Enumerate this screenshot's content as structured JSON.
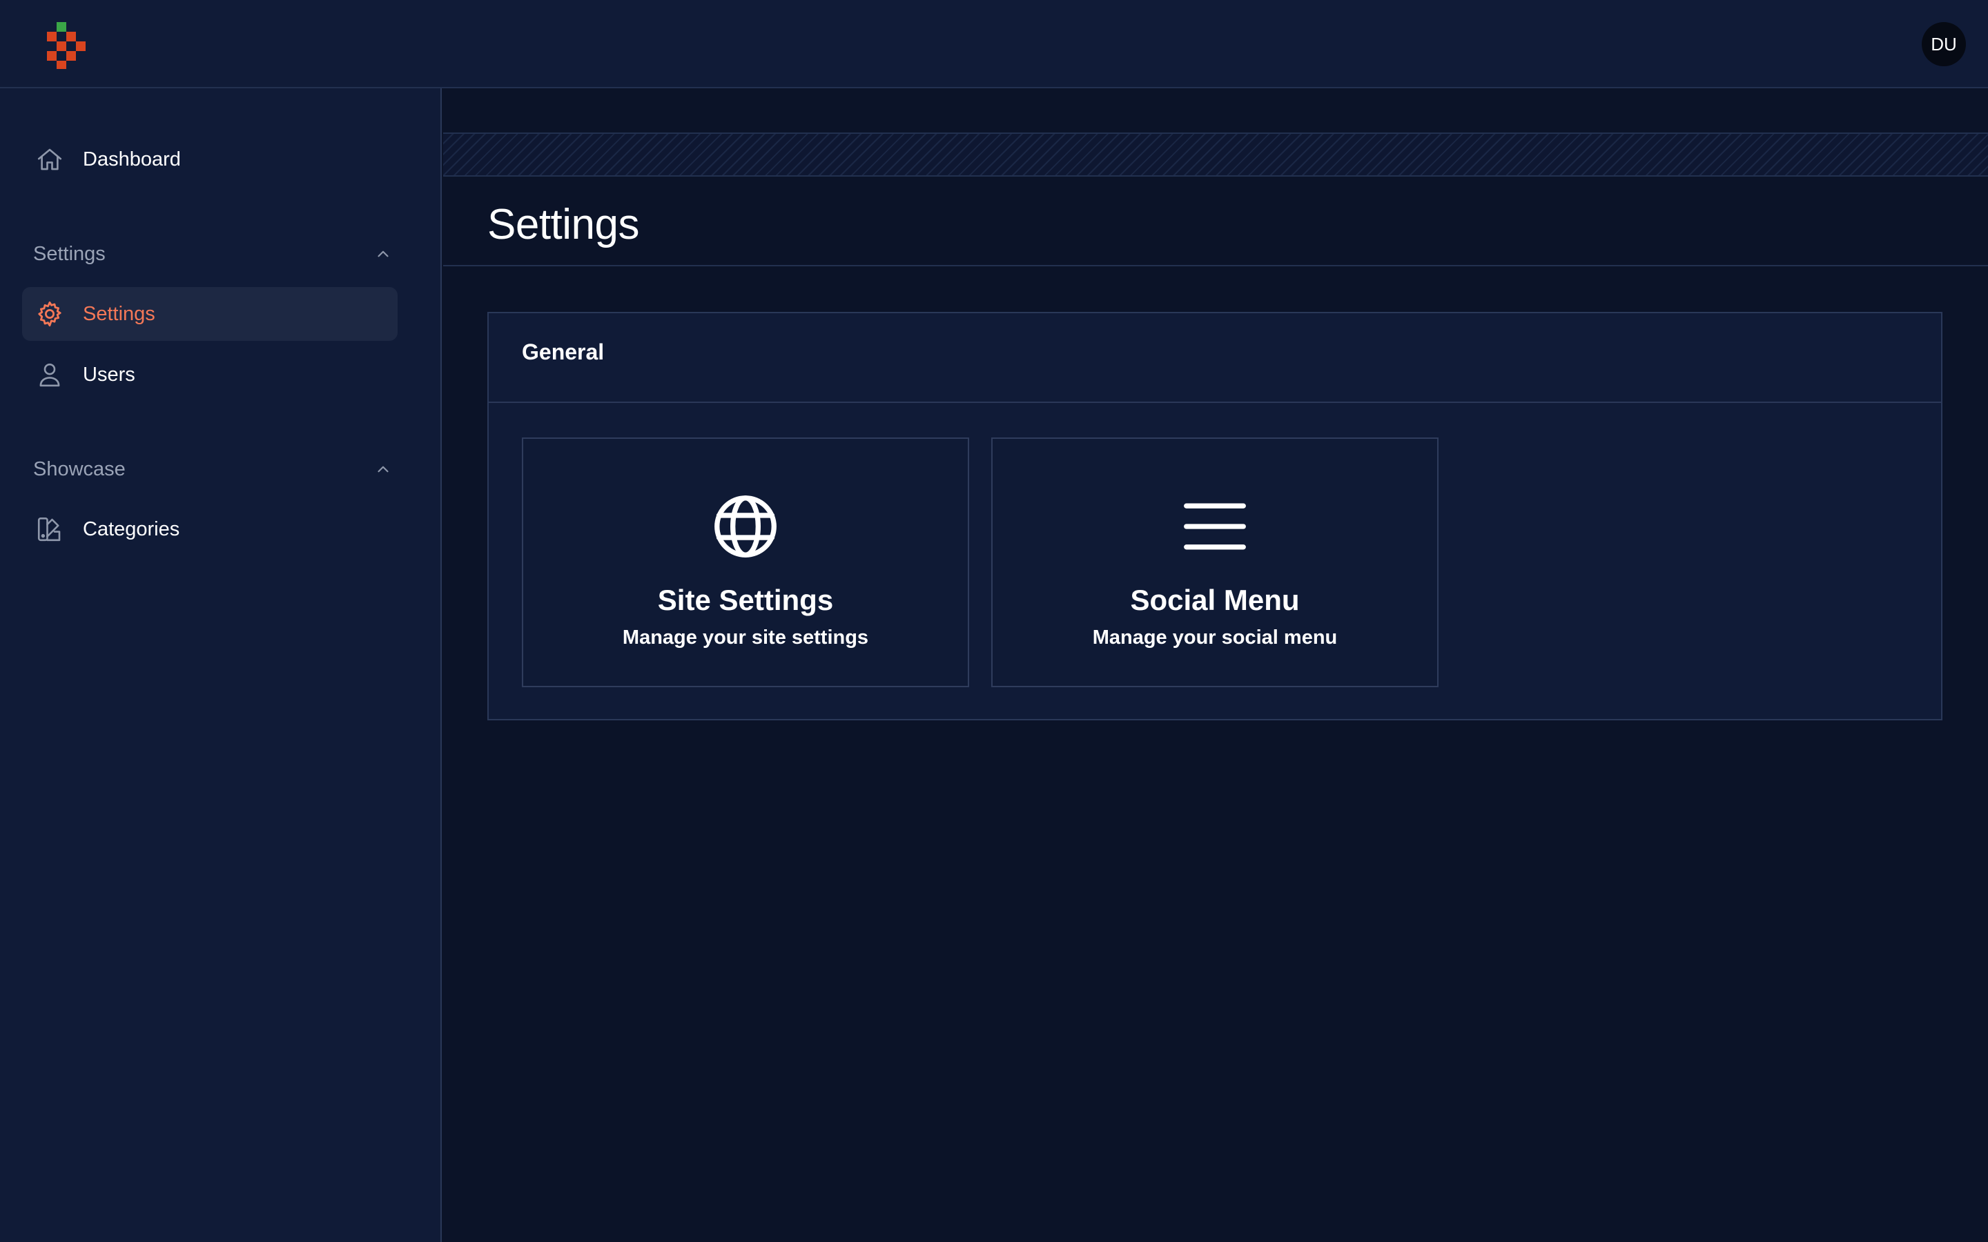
{
  "header": {
    "avatar_initials": "DU"
  },
  "sidebar": {
    "top_items": [
      {
        "label": "Dashboard",
        "icon": "home-icon"
      }
    ],
    "groups": [
      {
        "label": "Settings",
        "expanded": true,
        "items": [
          {
            "label": "Settings",
            "icon": "gear-icon",
            "active": true
          },
          {
            "label": "Users",
            "icon": "user-icon",
            "active": false
          }
        ]
      },
      {
        "label": "Showcase",
        "expanded": true,
        "items": [
          {
            "label": "Categories",
            "icon": "swatch-icon",
            "active": false
          }
        ]
      }
    ]
  },
  "main": {
    "page_title": "Settings",
    "panel": {
      "title": "General",
      "cards": [
        {
          "title": "Site Settings",
          "description": "Manage your site settings",
          "icon": "globe-icon"
        },
        {
          "title": "Social Menu",
          "description": "Manage your social menu",
          "icon": "menu-icon"
        }
      ]
    }
  },
  "colors": {
    "background": "#0b1328",
    "sidebar": "#101b37",
    "accent": "#f47857",
    "muted_text": "#9aa3b6",
    "border": "#2a3858"
  }
}
